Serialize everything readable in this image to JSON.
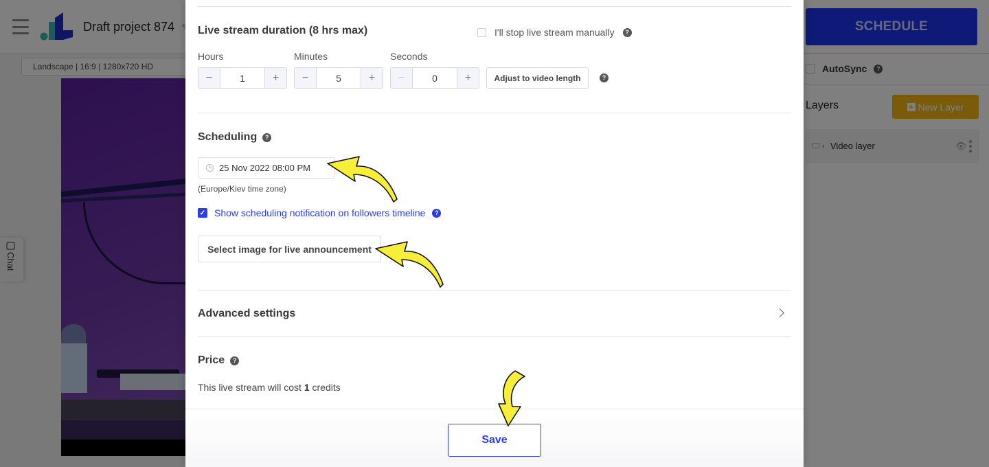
{
  "app": {
    "project_title": "Draft project 874",
    "format_select": "Landscape | 16:9 | 1280x720 HD",
    "schedule_button": "SCHEDULE",
    "chat_tab": "Chat",
    "autosync_label": "AutoSync",
    "layers_title": "Layers",
    "new_layer_button": "New Layer",
    "layers": [
      {
        "name": "Video layer",
        "icon": "video-camera-icon"
      }
    ]
  },
  "modal": {
    "duration": {
      "title": "Live stream duration (8 hrs max)",
      "manual_stop_label": "I'll stop live stream manually",
      "manual_stop_checked": false,
      "hours_label": "Hours",
      "hours_value": "1",
      "minutes_label": "Minutes",
      "minutes_value": "5",
      "seconds_label": "Seconds",
      "seconds_value": "0",
      "adjust_button": "Adjust to video length"
    },
    "scheduling": {
      "title": "Scheduling",
      "datetime_value": "25 Nov 2022 08:00 PM",
      "timezone_note": "(Europe/Kiev time zone)",
      "notify_label": "Show scheduling notification on followers timeline",
      "notify_checked": true,
      "select_image_button": "Select image for live announcement"
    },
    "advanced_settings_label": "Advanced settings",
    "price": {
      "title": "Price",
      "text_before": "This live stream will cost ",
      "credits": "1",
      "text_after": " credits"
    },
    "save_button": "Save"
  },
  "colors": {
    "accent_blue": "#2c3ce6",
    "schedule_blue": "#1f35f0",
    "new_layer_yellow": "#f4b613",
    "annotation_arrow": "#f7ee3a"
  }
}
